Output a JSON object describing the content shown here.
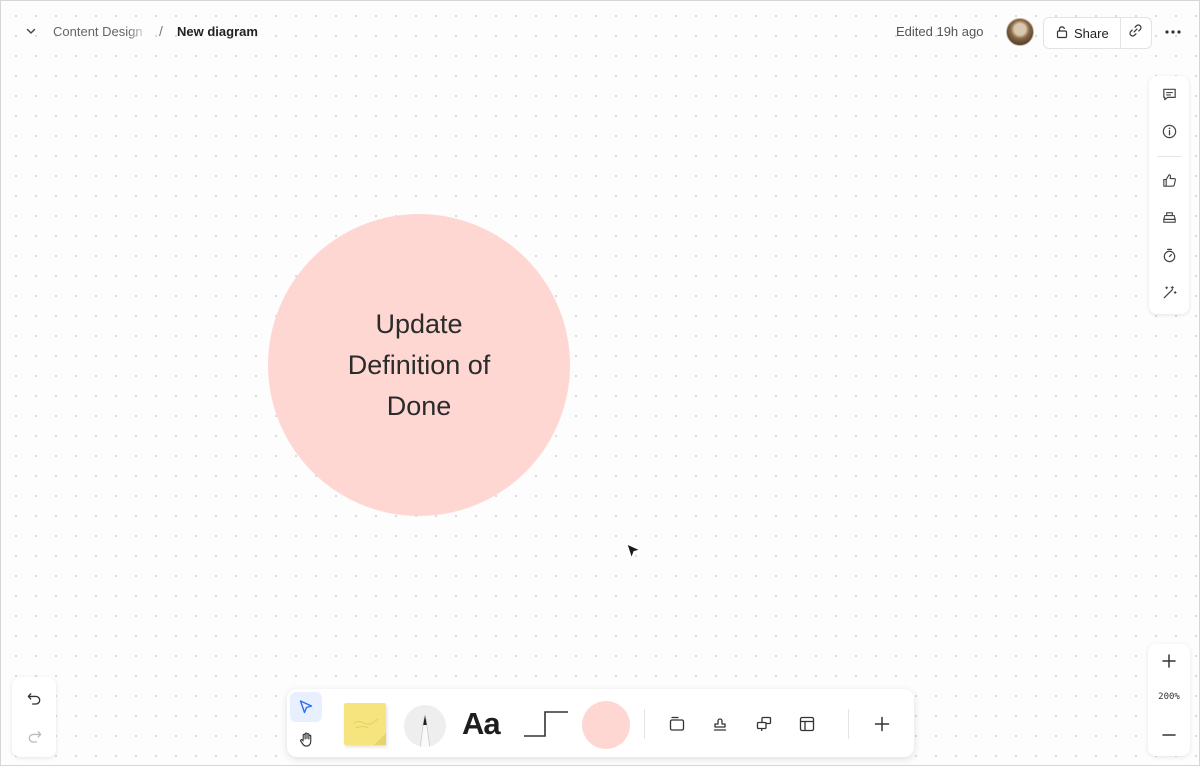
{
  "header": {
    "breadcrumb_parent": "Content Design",
    "breadcrumb_separator": "/",
    "breadcrumb_current": "New diagram",
    "edited_text": "Edited 19h ago",
    "share_label": "Share"
  },
  "canvas": {
    "shape_text": "Update Definition of Done",
    "shape_color": "#fed7d3"
  },
  "toolbar": {
    "text_tool_label": "Aa",
    "sticky_color": "#f6e57e",
    "shape_color": "#fed7d3",
    "active_mode": "select"
  },
  "zoom": {
    "level": "200%"
  },
  "icons": {
    "top": [
      "chevron-down-icon",
      "lock-icon",
      "link-icon",
      "more-icon"
    ],
    "rail": [
      "comment-icon",
      "info-icon",
      "thumbs-up-icon",
      "vote-icon",
      "timer-icon",
      "magic-wand-icon"
    ],
    "toolbar": [
      "select-arrow-icon",
      "hand-icon",
      "frame-icon",
      "stamp-icon",
      "components-icon",
      "template-icon",
      "plus-icon"
    ],
    "history": [
      "undo-icon",
      "redo-icon"
    ]
  }
}
